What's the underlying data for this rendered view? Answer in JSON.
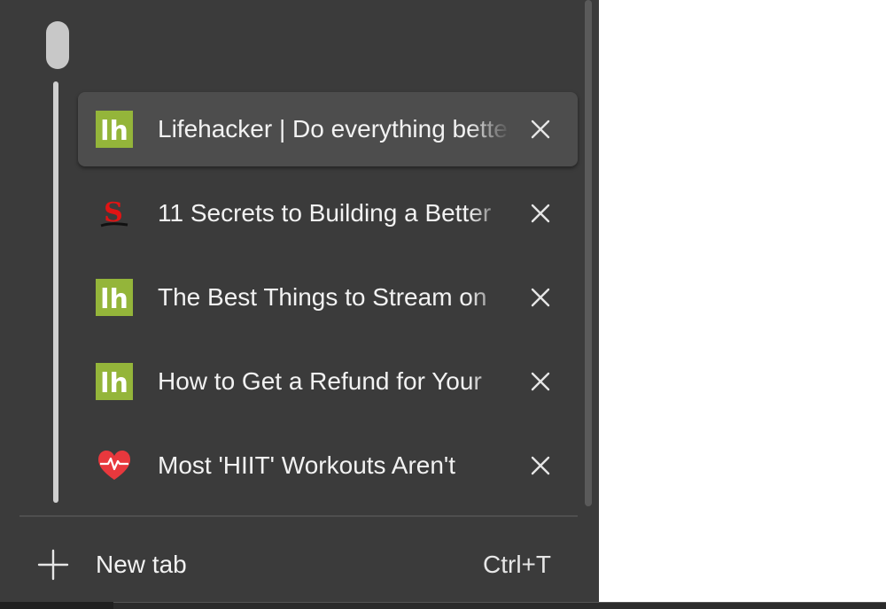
{
  "tabs": [
    {
      "title": "Lifehacker | Do everything better",
      "favicon": "lifehacker-icon",
      "active": true
    },
    {
      "title": "11 Secrets to Building a Better",
      "favicon": "s-logo-icon",
      "active": false
    },
    {
      "title": "The Best Things to Stream on",
      "favicon": "lifehacker-icon",
      "active": false
    },
    {
      "title": "How to Get a Refund for Your",
      "favicon": "lifehacker-icon",
      "active": false
    },
    {
      "title": "Most 'HIIT' Workouts Aren't",
      "favicon": "heart-pulse-icon",
      "active": false
    }
  ],
  "new_tab": {
    "label": "New tab",
    "shortcut": "Ctrl+T",
    "icon": "plus-icon"
  },
  "favicons": {
    "lifehacker": {
      "text": "lh",
      "bg": "#94b53a",
      "fg": "#ffffff"
    },
    "s_logo": {
      "text": "S",
      "color": "#e01414"
    },
    "heart": {
      "color": "#e8383d"
    }
  },
  "colors": {
    "panel_bg": "#3b3b3b",
    "active_tab_bg": "#4d4d4d",
    "text": "#f2f2f2",
    "content_bg": "#ffffff"
  }
}
